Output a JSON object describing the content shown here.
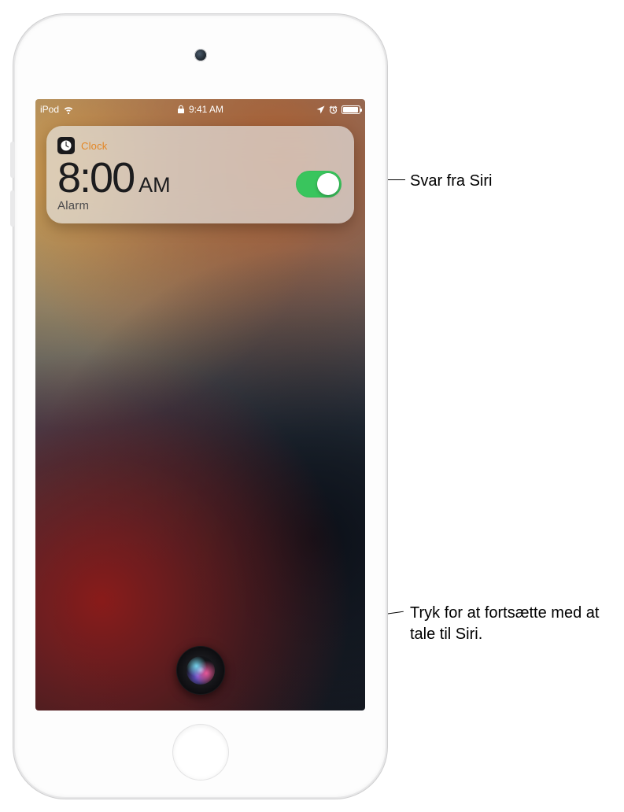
{
  "statusbar": {
    "carrier": "iPod",
    "time": "9:41 AM"
  },
  "notification": {
    "app_name": "Clock",
    "time": "8:00",
    "ampm": "AM",
    "label": "Alarm",
    "toggle_on": true
  },
  "callouts": {
    "response": "Svar fra Siri",
    "tap_to_continue": "Tryk for at fortsætte med at tale til Siri."
  }
}
